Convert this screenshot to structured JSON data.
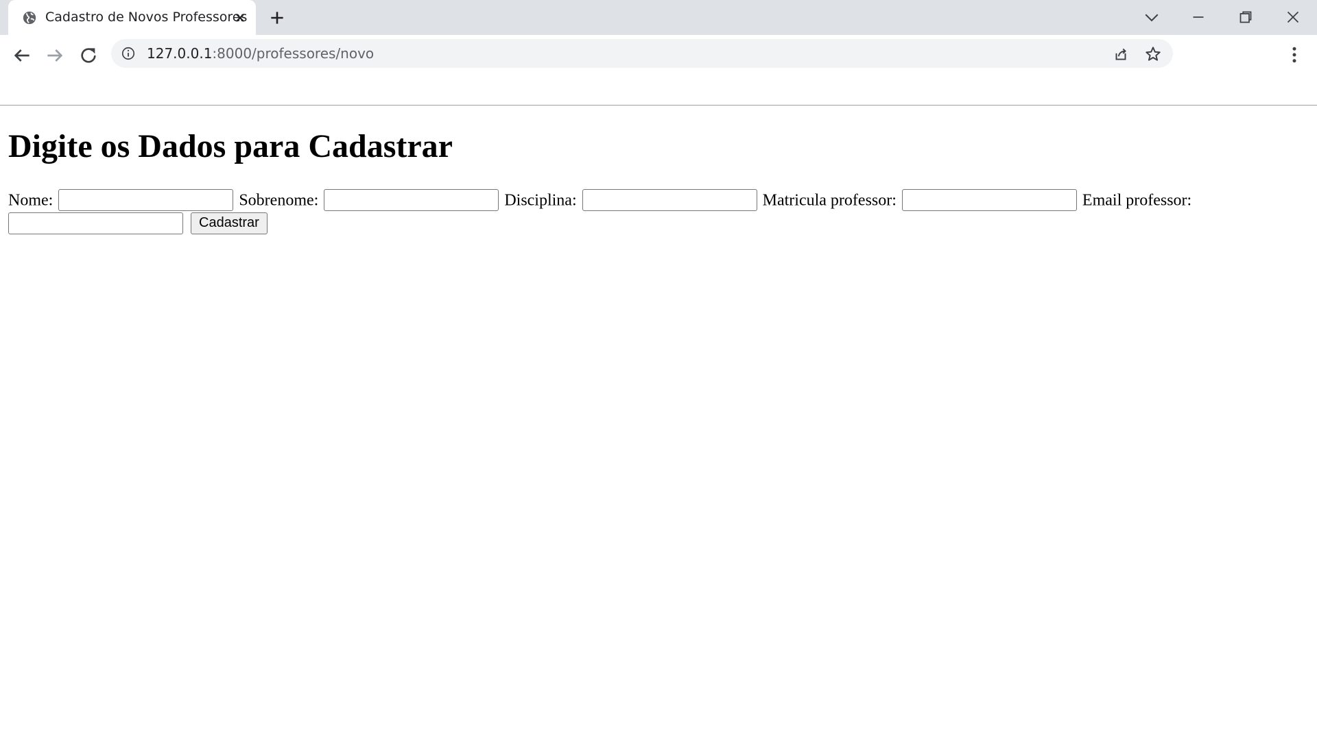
{
  "browser": {
    "tab": {
      "title": "Cadastro de Novos Professores",
      "favicon": "globe-icon"
    },
    "address_bar": {
      "host": "127.0.0.1",
      "path": ":8000/professores/novo"
    },
    "icons": {
      "back": "arrow-left-icon",
      "forward": "arrow-right-icon",
      "reload": "reload-icon",
      "info": "info-icon",
      "share": "share-icon",
      "bookmark": "star-icon",
      "menu": "kebab-menu-icon",
      "new_tab": "plus-icon",
      "tab_search": "chevron-down-icon",
      "minimize": "minimize-icon",
      "restore": "restore-icon",
      "close": "close-icon"
    }
  },
  "page": {
    "heading": "Digite os Dados para Cadastrar",
    "form": {
      "fields": [
        {
          "label": "Nome:",
          "value": ""
        },
        {
          "label": "Sobrenome:",
          "value": ""
        },
        {
          "label": "Disciplina:",
          "value": ""
        },
        {
          "label": "Matricula professor:",
          "value": ""
        },
        {
          "label": "Email professor:",
          "value": ""
        }
      ],
      "submit_label": "Cadastrar"
    }
  }
}
